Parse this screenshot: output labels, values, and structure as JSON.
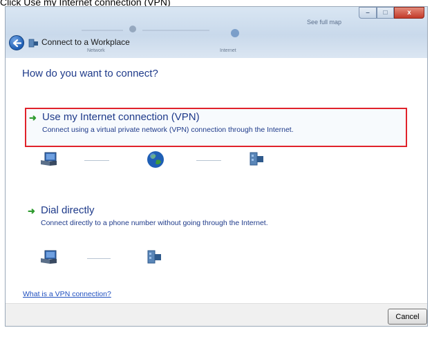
{
  "caption": "Click Use my Internet connection (VPN)",
  "window": {
    "title": "Connect to a Workplace",
    "map": {
      "see_full_map": "See full map",
      "network_label": "Network",
      "internet_label": "Internet"
    },
    "buttons": {
      "minimize": "–",
      "maximize": "□",
      "close": "x"
    }
  },
  "heading": "How do you want to connect?",
  "options": [
    {
      "title": "Use my Internet connection (VPN)",
      "description": "Connect using a virtual private network (VPN) connection through the Internet.",
      "highlighted": true,
      "highlight_color": "#e0222a"
    },
    {
      "title": "Dial directly",
      "description": "Connect directly to a phone number without going through the Internet.",
      "highlighted": false
    }
  ],
  "icons": [
    "computer-icon",
    "globe-icon",
    "workplace-icon",
    "arrow-icon",
    "back-icon"
  ],
  "help_link": "What is a VPN connection?",
  "footer": {
    "cancel_label": "Cancel"
  },
  "colors": {
    "accent": "#1e3a8a",
    "link": "#1f4fbf",
    "arrow": "#2e9b2e"
  }
}
